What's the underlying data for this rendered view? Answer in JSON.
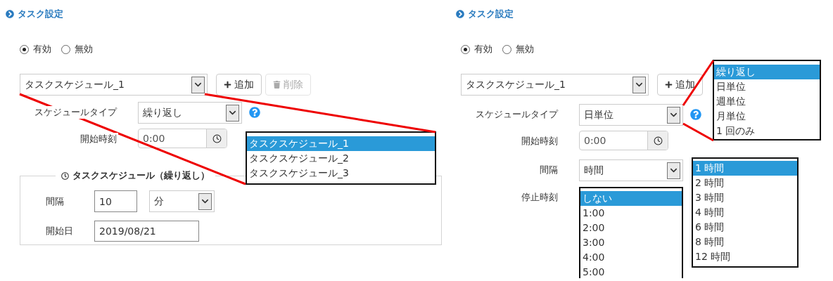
{
  "panels": [
    {
      "title": "タスク設定",
      "status_options": [
        {
          "label": "有効",
          "selected": true
        },
        {
          "label": "無効",
          "selected": false
        }
      ],
      "schedule": {
        "value": "タスクスケジュール_1"
      },
      "buttons": [
        {
          "label": "追加",
          "kind": "add",
          "disabled": false
        },
        {
          "label": "削除",
          "kind": "delete",
          "disabled": true
        }
      ],
      "fields": [
        {
          "kind": "select",
          "label": "スケジュールタイプ",
          "value": "繰り返し",
          "help": true
        },
        {
          "kind": "time",
          "label": "開始時刻",
          "value": "0:00"
        }
      ],
      "fieldset": {
        "legend": "タスクスケジュール（繰り返し）",
        "rows": [
          {
            "label": "間隔",
            "number": "10",
            "unit": "分"
          },
          {
            "label": "開始日",
            "date": "2019/08/21"
          }
        ]
      },
      "popups": [
        {
          "options": [
            {
              "label": "タスクスケジュール_1",
              "selected": true
            },
            {
              "label": "タスクスケジュール_2",
              "selected": false
            },
            {
              "label": "タスクスケジュール_3",
              "selected": false
            }
          ]
        }
      ]
    },
    {
      "title": "タスク設定",
      "status_options": [
        {
          "label": "有効",
          "selected": true
        },
        {
          "label": "無効",
          "selected": false
        }
      ],
      "schedule": {
        "value": "タスクスケジュール_1"
      },
      "buttons": [
        {
          "label": "追加",
          "kind": "add",
          "disabled": false
        }
      ],
      "fields": [
        {
          "kind": "select",
          "label": "スケジュールタイプ",
          "value": "日単位",
          "help": true
        },
        {
          "kind": "time",
          "label": "開始時刻",
          "value": "0:00"
        },
        {
          "kind": "select",
          "label": "間隔",
          "value": "時間"
        },
        {
          "kind": "listbox",
          "label": "停止時刻",
          "options": [
            {
              "label": "しない",
              "selected": true
            },
            {
              "label": "1:00",
              "selected": false
            },
            {
              "label": "2:00",
              "selected": false
            },
            {
              "label": "3:00",
              "selected": false
            },
            {
              "label": "4:00",
              "selected": false
            },
            {
              "label": "5:00",
              "selected": false
            }
          ]
        }
      ],
      "popups": [
        {
          "options": [
            {
              "label": "繰り返し",
              "selected": true
            },
            {
              "label": "日単位",
              "selected": false
            },
            {
              "label": "週単位",
              "selected": false
            },
            {
              "label": "月単位",
              "selected": false
            },
            {
              "label": "1 回のみ",
              "selected": false
            }
          ]
        },
        {
          "options": [
            {
              "label": "1 時間",
              "selected": true
            },
            {
              "label": "2 時間",
              "selected": false
            },
            {
              "label": "3 時間",
              "selected": false
            },
            {
              "label": "4 時間",
              "selected": false
            },
            {
              "label": "6 時間",
              "selected": false
            },
            {
              "label": "8 時間",
              "selected": false
            },
            {
              "label": "12 時間",
              "selected": false
            }
          ]
        }
      ]
    }
  ]
}
